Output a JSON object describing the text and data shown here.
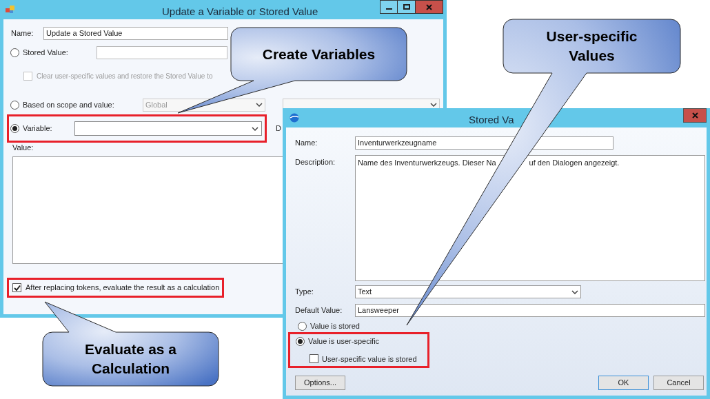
{
  "main_window": {
    "title": "Update a Variable or Stored Value",
    "name": {
      "label": "Name:",
      "value": "Update a Stored Value"
    },
    "stored_value_option": {
      "label": "Stored Value:",
      "selected": false
    },
    "clear_option": {
      "label": "Clear user-specific values and restore the Stored Value to",
      "checked": false,
      "disabled": true
    },
    "scope_option": {
      "label": "Based on scope and value:",
      "selected": false,
      "scope_value": "Global"
    },
    "variable_option": {
      "label": "Variable:",
      "selected": true,
      "highlighted": true
    },
    "cut_label": "D",
    "value_label": "Value:",
    "evaluate_option": {
      "label": "After replacing tokens, evaluate the result as a calculation",
      "checked": true,
      "highlighted": true
    }
  },
  "stored_value_window": {
    "title": "Stored Va",
    "name": {
      "label": "Name:",
      "value": "Inventurwerkzeugname"
    },
    "description": {
      "label": "Description:",
      "fragments": [
        "Name des Inventurwerkzeugs. Dieser Na",
        "uf den Dialogen angezeigt."
      ]
    },
    "type": {
      "label": "Type:",
      "value": "Text"
    },
    "default_value": {
      "label": "Default Value:",
      "value": "Lansweeper"
    },
    "radios": [
      {
        "label": "Value is stored",
        "selected": false
      },
      {
        "label": "Value is user-specific",
        "selected": true
      }
    ],
    "user_stored": {
      "label": "User-specific value is stored",
      "checked": false
    },
    "highlighted": true,
    "buttons": [
      {
        "label": "Options...",
        "default": false
      },
      {
        "label": "OK",
        "default": true
      },
      {
        "label": "Cancel",
        "default": false
      }
    ]
  },
  "callouts": [
    {
      "text": "Create Variables"
    },
    {
      "text": "User-specific Values"
    },
    {
      "text": "Evaluate as a Calculation"
    }
  ]
}
